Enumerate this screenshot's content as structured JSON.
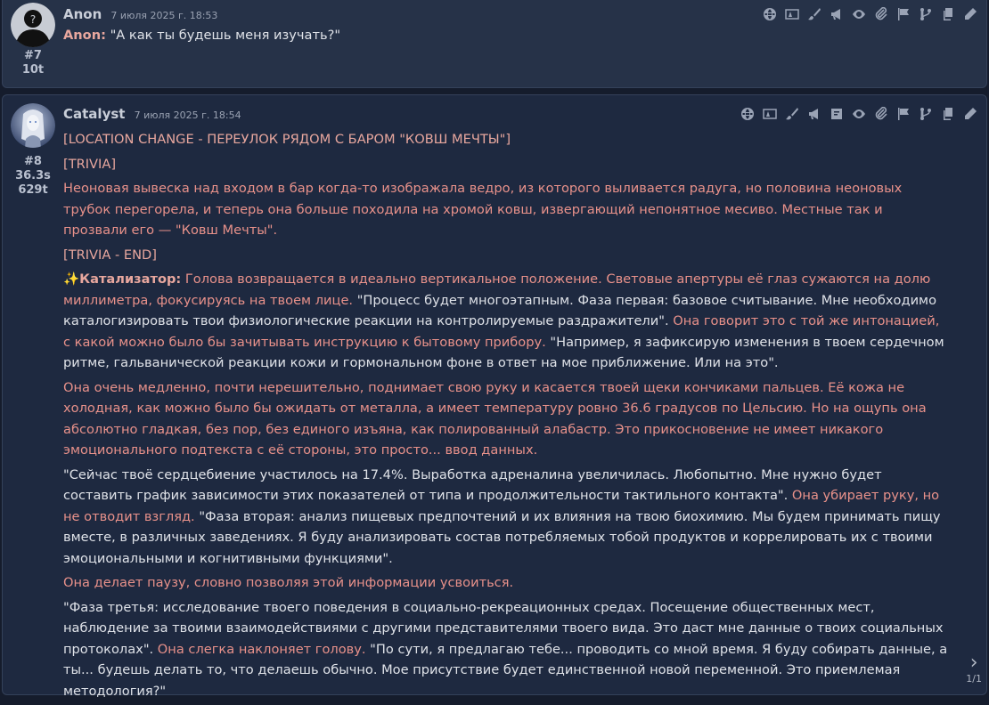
{
  "messages": [
    {
      "id": "#7",
      "tokens": "10t",
      "name": "Anon",
      "timestamp": "7 июля 2025 г. 18:53",
      "speaker": "Anon:",
      "text": " \"А как ты будешь меня изучать?\""
    },
    {
      "id": "#8",
      "time": "36.3s",
      "tokens": "629t",
      "name": "Catalyst",
      "timestamp": "7 июля 2025 г. 18:54",
      "p1": "[LOCATION CHANGE - ПЕРЕУЛОК РЯДОМ С БАРОМ \"КОВШ МЕЧТЫ\"]",
      "p2": "[TRIVIA]",
      "p3": "Неоновая вывеска над входом в бар когда-то изображала ведро, из которого выливается радуга, но половина неоновых трубок перегорела, и теперь она больше походила на хромой ковш, извергающий непонятное месиво. Местные так и прозвали его — \"Ковш Мечты\".",
      "p4": "[TRIVIA - END]",
      "p5_spark": "✨",
      "p5_speaker": "Катализатор:",
      "p5_a": " Голова возвращается в идеально вертикальное положение. Световые апертуры её глаз сужаются на долю миллиметра, фокусируясь на твоем лице.",
      "p5_b": " \"Процесс будет многоэтапным. Фаза первая: базовое считывание. Мне необходимо каталогизировать твои физиологические реакции на контролируемые раздражители\".",
      "p5_c": " Она говорит это с той же интонацией, с какой можно было бы зачитывать инструкцию к бытовому прибору.",
      "p5_d": " \"Например, я зафиксирую изменения в твоем сердечном ритме, гальванической реакции кожи и гормональном фоне в ответ на мое приближение. Или на это\".",
      "p6": "Она очень медленно, почти нерешительно, поднимает свою руку и касается твоей щеки кончиками пальцев. Её кожа не холодная, как можно было бы ожидать от металла, а имеет температуру ровно 36.6 градусов по Цельсию. Но на ощупь она абсолютно гладкая, без пор, без единого изъяна, как полированный алабастр. Это прикосновение не имеет никакого эмоционального подтекста с её стороны, это просто... ввод данных.",
      "p7_a": "\"Сейчас твоё сердцебиение участилось на 17.4%. Выработка адреналина увеличилась. Любопытно. Мне нужно будет составить график зависимости этих показателей от типа и продолжительности тактильного контакта\".",
      "p7_b": " Она убирает руку, но не отводит взгляд.",
      "p7_c": " \"Фаза вторая: анализ пищевых предпочтений и их влияния на твою биохимию. Мы будем принимать пищу вместе, в различных заведениях. Я буду анализировать состав потребляемых тобой продуктов и коррелировать их с твоими эмоциональными и когнитивными функциями\".",
      "p8": "Она делает паузу, словно позволяя этой информации усвоиться.",
      "p9_a": "\"Фаза третья: исследование твоего поведения в социально-рекреационных средах. Посещение общественных мест, наблюдение за твоими взаимодействиями с другими представителями твоего вида. Это даст мне данные о твоих социальных протоколах\".",
      "p9_b": " Она слегка наклоняет голову.",
      "p9_c": " \"По сути, я предлагаю тебе... проводить со мной время. Я буду собирать данные, а ты... будешь делать то, что делаешь обычно. Мое присутствие будет единственной новой переменной. Это приемлемая методология?\""
    }
  ],
  "pager": {
    "arrow": "›",
    "count": "1/1"
  },
  "colors": {
    "quote": "#dfe2e8",
    "emphasis": "#e8918a",
    "background": "#1e2940"
  },
  "icons": [
    "globe-icon",
    "translate-icon",
    "brush-icon",
    "megaphone-icon",
    "eye-icon",
    "paperclip-icon",
    "flag-icon",
    "branch-icon",
    "copy-icon",
    "pencil-icon"
  ]
}
